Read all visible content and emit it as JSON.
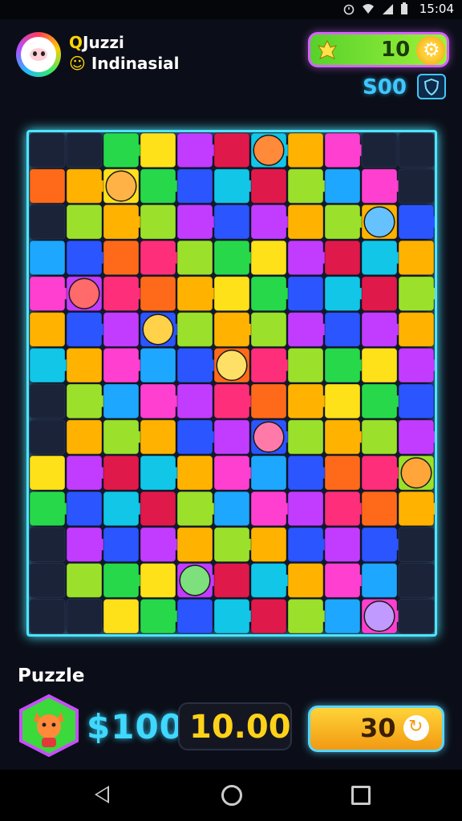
{
  "status_bar": {
    "time": "15:04"
  },
  "header": {
    "title_line1": "Juzzi",
    "title_line2": "Indinasial",
    "title_prefix1": "Q",
    "coins": "10",
    "score": "S00"
  },
  "board": {
    "palette": [
      "#ff2e7a",
      "#ffb300",
      "#27d94a",
      "#1ea7ff",
      "#c23cff",
      "#ff6a1a",
      "#12c6e8",
      "#9be12b",
      "#ff3fd0",
      "#ffe11a",
      "#2b55ff",
      "#e0194b"
    ],
    "rows": 14,
    "cols": 11,
    "empty_cells": [
      [
        0,
        0
      ],
      [
        0,
        1
      ],
      [
        0,
        9
      ],
      [
        0,
        10
      ],
      [
        1,
        10
      ],
      [
        2,
        0
      ],
      [
        7,
        0
      ],
      [
        8,
        0
      ],
      [
        11,
        0
      ],
      [
        12,
        0
      ],
      [
        13,
        0
      ],
      [
        13,
        1
      ],
      [
        13,
        10
      ],
      [
        12,
        10
      ],
      [
        11,
        10
      ]
    ]
  },
  "bottom": {
    "label": "Puzzle",
    "money": "$100",
    "timer": "10.00",
    "action_value": "30"
  }
}
